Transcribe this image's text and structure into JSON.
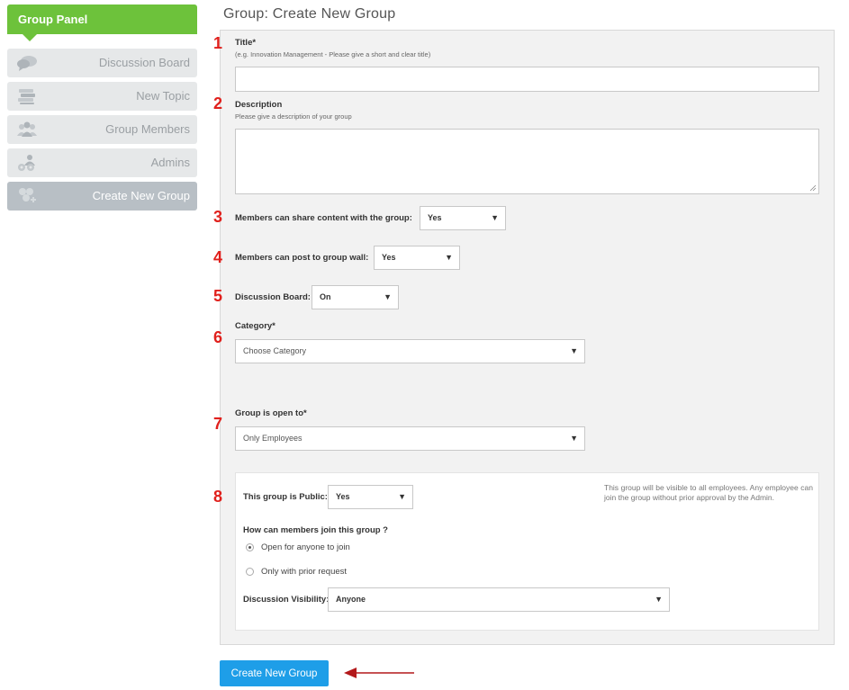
{
  "sidebar": {
    "header": "Group Panel",
    "items": [
      {
        "label": "Discussion Board",
        "icon": "speech-bubbles-icon"
      },
      {
        "label": "New Topic",
        "icon": "stacked-books-icon"
      },
      {
        "label": "Group Members",
        "icon": "group-people-icon"
      },
      {
        "label": "Admins",
        "icon": "admin-gears-icon"
      },
      {
        "label": "Create New Group",
        "icon": "create-group-icon",
        "active": true
      }
    ]
  },
  "page": {
    "title": "Group: Create New Group"
  },
  "markers": [
    "1",
    "2",
    "3",
    "4",
    "5",
    "6",
    "7",
    "8"
  ],
  "form": {
    "title": {
      "label": "Title*",
      "hint": "(e.g. Innovation Management - Please give a short and clear title)",
      "value": ""
    },
    "description": {
      "label": "Description",
      "hint": "Please give a description of your group",
      "value": ""
    },
    "share_content": {
      "label": "Members can share content with the group:",
      "value": "Yes"
    },
    "post_wall": {
      "label": "Members can post to group wall:",
      "value": "Yes"
    },
    "discussion_board": {
      "label": "Discussion Board:",
      "value": "On"
    },
    "category": {
      "label": "Category*",
      "value": "Choose Category"
    },
    "open_to": {
      "label": "Group is open to*",
      "value": "Only Employees"
    },
    "public": {
      "label": "This group is Public:",
      "value": "Yes",
      "note": "This group will be visible to all employees. Any employee can join the group without prior approval by the Admin."
    },
    "join": {
      "label": "How can members join this group ?",
      "options": [
        {
          "label": "Open for anyone to join",
          "checked": true
        },
        {
          "label": "Only with prior request",
          "checked": false
        }
      ]
    },
    "discussion_visibility": {
      "label": "Discussion Visibility:",
      "value": "Anyone"
    },
    "submit_label": "Create New Group"
  },
  "colors": {
    "panel_green": "#6dc23b",
    "button_blue": "#1e9ee8",
    "marker_red": "#e0201c",
    "arrow_red": "#b3191b"
  }
}
